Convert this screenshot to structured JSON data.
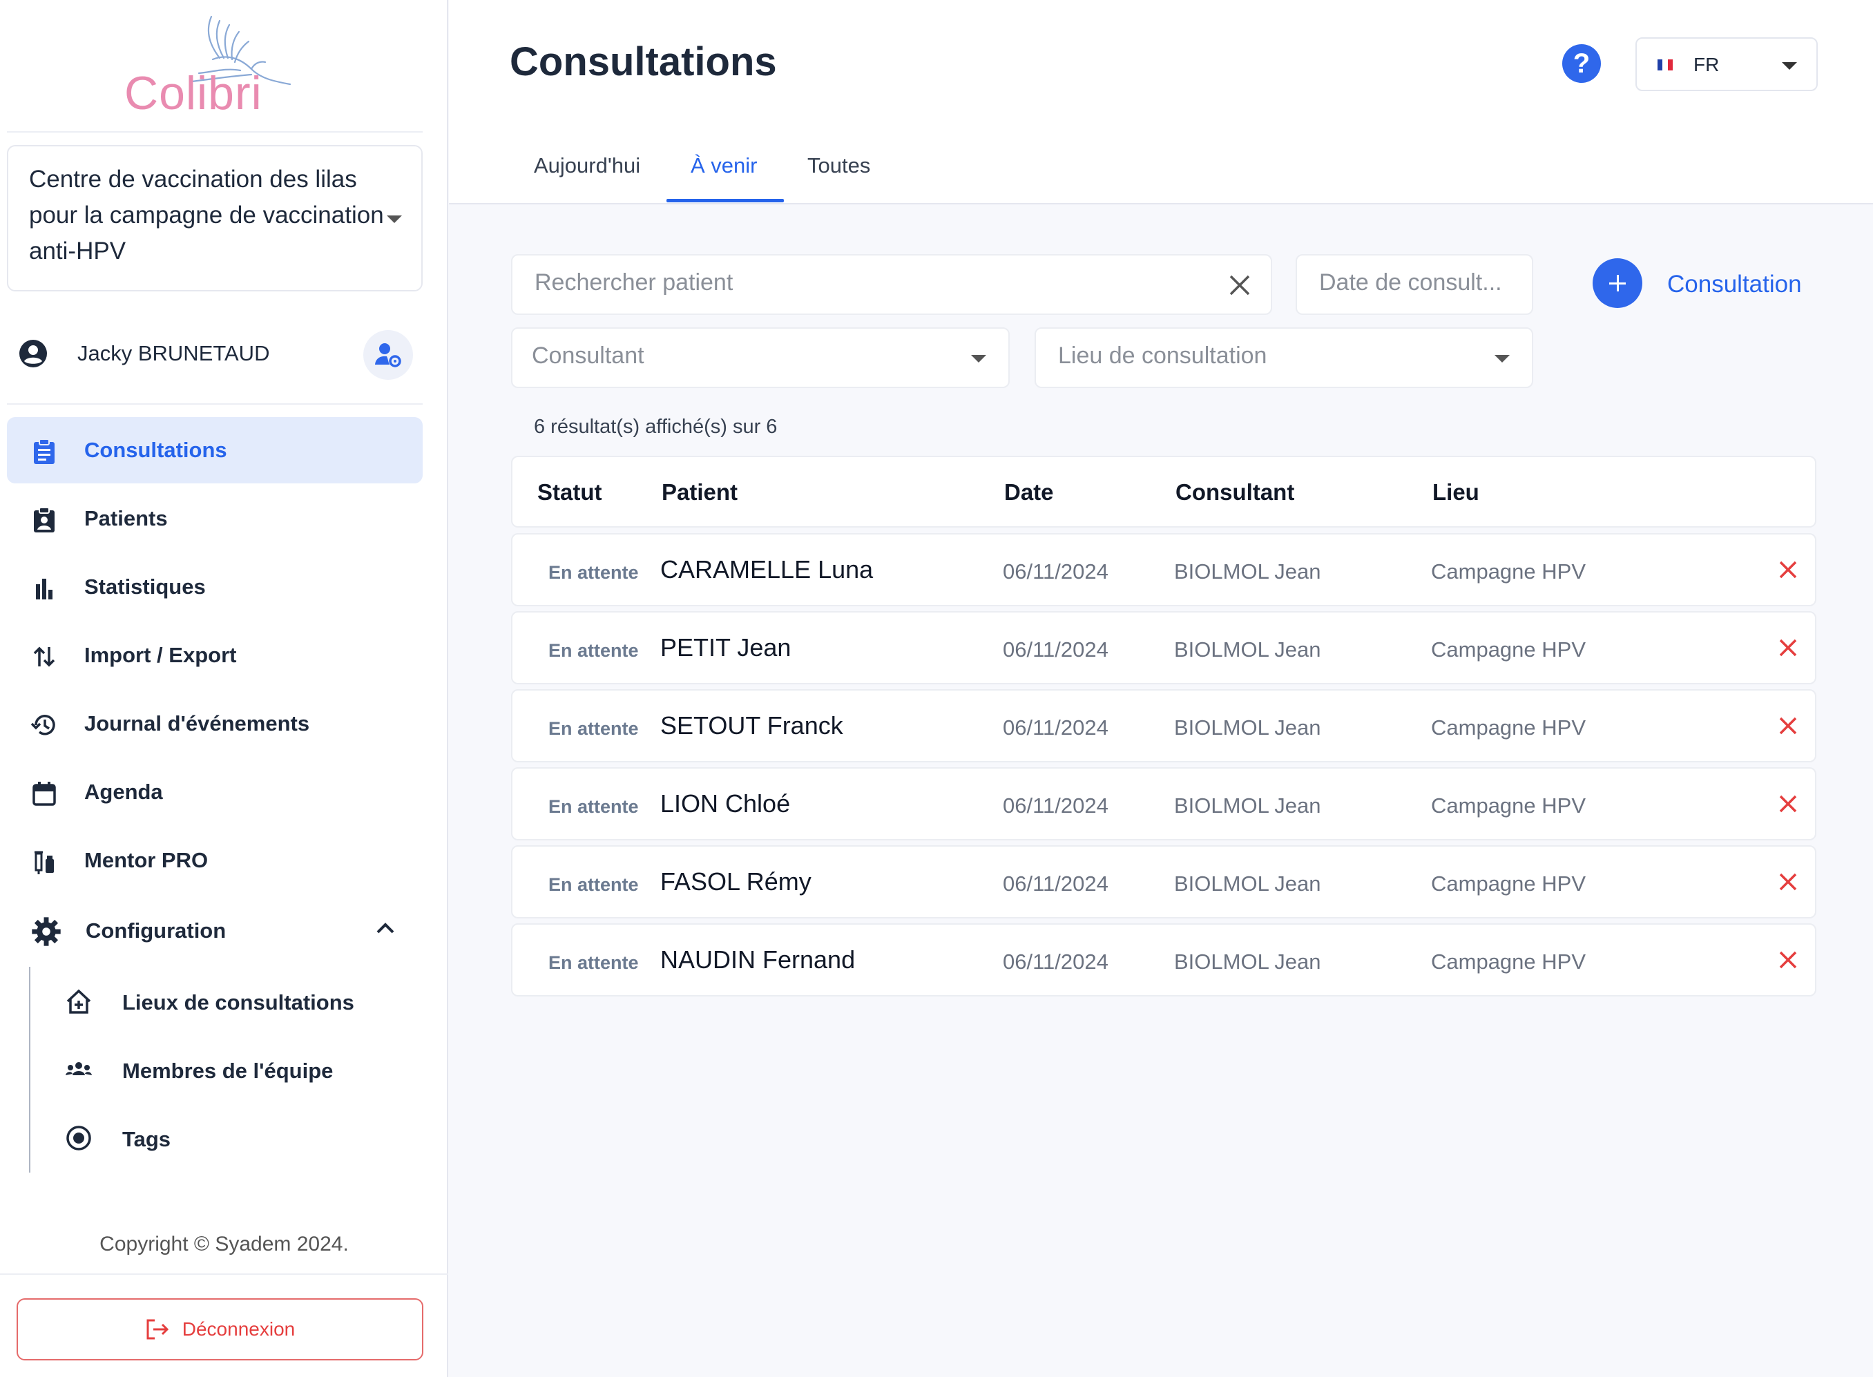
{
  "brand": {
    "name": "Colibri"
  },
  "center": {
    "label": "Centre de vaccination des lilas pour la campagne de vaccination anti-HPV"
  },
  "user": {
    "name": "Jacky BRUNETAUD"
  },
  "nav": {
    "consultations": "Consultations",
    "patients": "Patients",
    "statistiques": "Statistiques",
    "import_export": "Import / Export",
    "journal": "Journal d'événements",
    "agenda": "Agenda",
    "mentor": "Mentor PRO",
    "configuration": "Configuration",
    "lieux": "Lieux de consultations",
    "membres": "Membres de l'équipe",
    "tags": "Tags"
  },
  "footer": {
    "copyright": "Copyright © Syadem 2024.",
    "logout": "Déconnexion"
  },
  "header": {
    "title": "Consultations",
    "help": "?",
    "lang": "FR",
    "tabs": [
      "Aujourd'hui",
      "À venir",
      "Toutes"
    ],
    "active_tab": "À venir"
  },
  "filters": {
    "search_placeholder": "Rechercher patient",
    "date_placeholder": "Date de consult...",
    "consultant_placeholder": "Consultant",
    "lieu_placeholder": "Lieu de consultation",
    "add_label": "Consultation"
  },
  "results": "6 résultat(s) affiché(s) sur 6",
  "table": {
    "columns": [
      "Statut",
      "Patient",
      "Date",
      "Consultant",
      "Lieu"
    ],
    "rows": [
      {
        "statut": "En attente",
        "patient": "CARAMELLE Luna",
        "date": "06/11/2024",
        "consultant": "BIOLMOL Jean",
        "lieu": "Campagne HPV"
      },
      {
        "statut": "En attente",
        "patient": "PETIT Jean",
        "date": "06/11/2024",
        "consultant": "BIOLMOL Jean",
        "lieu": "Campagne HPV"
      },
      {
        "statut": "En attente",
        "patient": "SETOUT Franck",
        "date": "06/11/2024",
        "consultant": "BIOLMOL Jean",
        "lieu": "Campagne HPV"
      },
      {
        "statut": "En attente",
        "patient": "LION Chloé",
        "date": "06/11/2024",
        "consultant": "BIOLMOL Jean",
        "lieu": "Campagne HPV"
      },
      {
        "statut": "En attente",
        "patient": "FASOL Rémy",
        "date": "06/11/2024",
        "consultant": "BIOLMOL Jean",
        "lieu": "Campagne HPV"
      },
      {
        "statut": "En attente",
        "patient": "NAUDIN Fernand",
        "date": "06/11/2024",
        "consultant": "BIOLMOL Jean",
        "lieu": "Campagne HPV"
      }
    ]
  },
  "colors": {
    "accent": "#2563eb",
    "danger": "#e53e3e",
    "brand_pink": "#e98bb0"
  }
}
